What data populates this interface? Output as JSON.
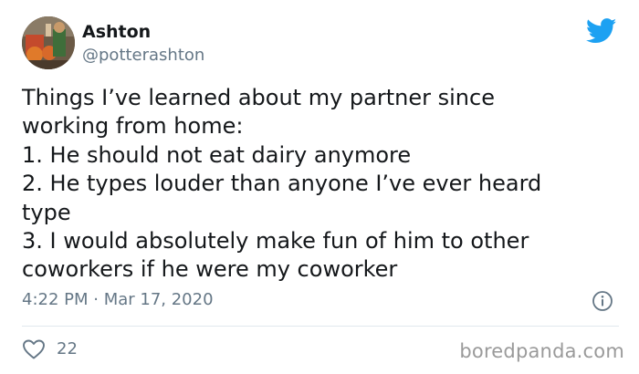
{
  "tweet": {
    "author_name": "Ashton",
    "author_handle": "@potterashton",
    "text": "Things I’ve learned about my partner since\nworking from home:\n1. He should not eat dairy anymore\n2. He types louder than anyone I’ve ever heard\ntype\n3. I would absolutely make fun of him to other\ncoworkers if he were my coworker",
    "timestamp": "4:22 PM · Mar 17, 2020",
    "like_count": "22"
  },
  "icons": {
    "brand": "twitter-bird-icon",
    "info": "info-icon",
    "like": "heart-icon"
  },
  "colors": {
    "twitter_blue": "#1da1f2",
    "secondary_text": "#657786",
    "divider": "#e1e8ed"
  },
  "watermark": "boredpanda.com"
}
